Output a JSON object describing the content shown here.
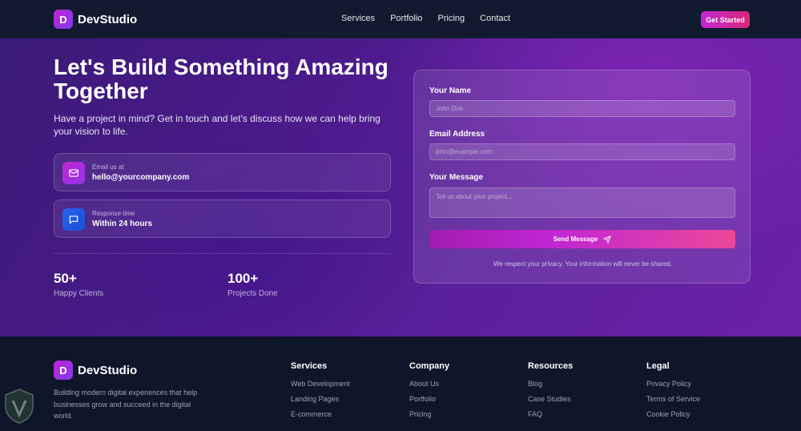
{
  "nav": {
    "brand_letter": "D",
    "brand_name": "DevStudio",
    "links": [
      "Services",
      "Portfolio",
      "Pricing",
      "Contact"
    ],
    "cta_label": "Get Started"
  },
  "hero": {
    "title": "Let's Build Something Amazing Together",
    "subtitle": "Have a project in mind? Get in touch and let's discuss how we can help bring your vision to life.",
    "email_card": {
      "icon": "mail-icon",
      "label": "Email us at",
      "value": "hello@yourcompany.com"
    },
    "response_card": {
      "icon": "chat-icon",
      "label": "Response time",
      "value": "Within 24 hours"
    },
    "stats": [
      {
        "value": "50+",
        "label": "Happy Clients"
      },
      {
        "value": "100+",
        "label": "Projects Done"
      }
    ]
  },
  "form": {
    "name_label": "Your Name",
    "name_placeholder": "John Doe",
    "email_label": "Email Address",
    "email_placeholder": "john@example.com",
    "message_label": "Your Message",
    "message_placeholder": "Tell us about your project...",
    "submit_label": "Send Message",
    "privacy_note": "We respect your privacy. Your information will never be shared."
  },
  "footer": {
    "brand_letter": "D",
    "brand_name": "DevStudio",
    "description": "Building modern digital experiences that help businesses grow and succeed in the digital world.",
    "columns": [
      {
        "title": "Services",
        "links": [
          "Web Development",
          "Landing Pages",
          "E-commerce"
        ]
      },
      {
        "title": "Company",
        "links": [
          "About Us",
          "Portfolio",
          "Pricing"
        ]
      },
      {
        "title": "Resources",
        "links": [
          "Blog",
          "Case Studies",
          "FAQ"
        ]
      },
      {
        "title": "Legal",
        "links": [
          "Privacy Policy",
          "Terms of Service",
          "Cookie Policy"
        ]
      }
    ]
  },
  "colors": {
    "accent": "#c026d3",
    "accent_pink": "#db2777",
    "footer_bg": "#0f1629"
  }
}
